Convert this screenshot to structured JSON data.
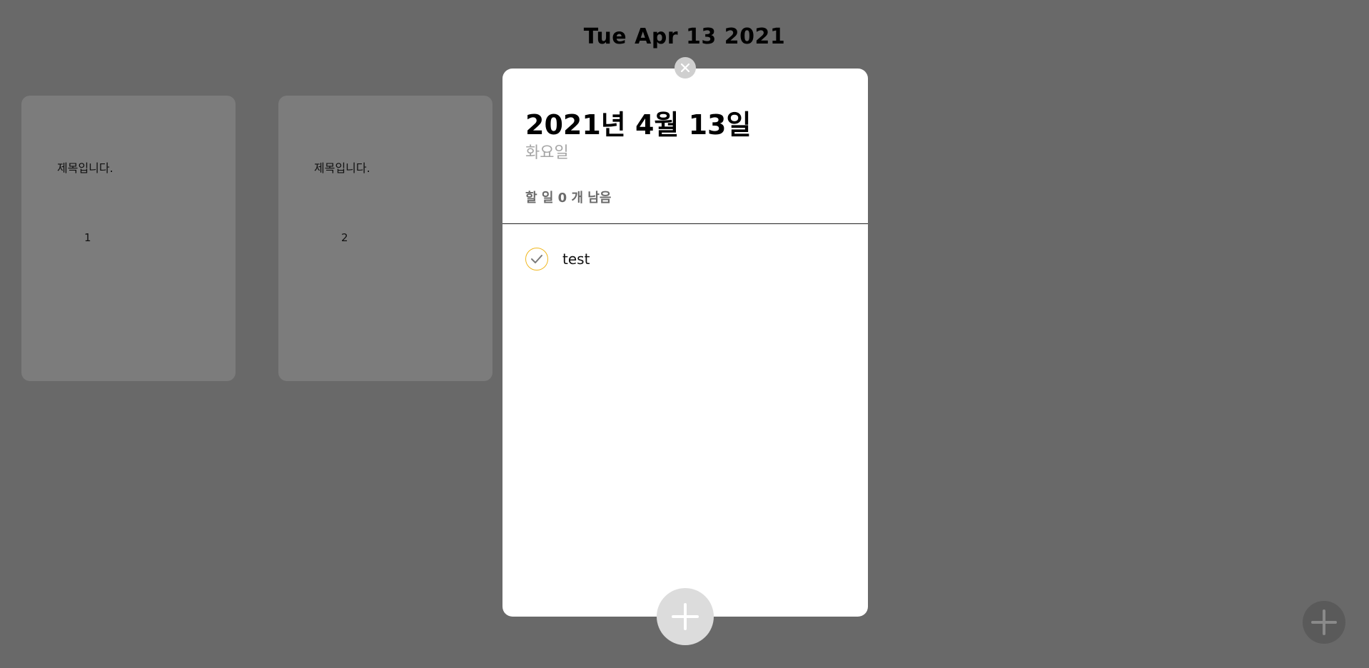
{
  "header": {
    "date": "Tue Apr 13 2021"
  },
  "cards": [
    {
      "title": "제목입니다.",
      "number": "1"
    },
    {
      "title": "제목입니다.",
      "number": "2"
    }
  ],
  "modal": {
    "date": "2021년 4월 13일",
    "weekday": "화요일",
    "remaining": "할 일 0 개 남음",
    "todos": [
      {
        "text": "test",
        "done": true
      }
    ]
  },
  "colors": {
    "background": "#696969",
    "card": "#7c7c7c",
    "check_border": "#f0b71f",
    "modal_background": "#ffffff"
  },
  "icons": {
    "close": "close-icon",
    "check": "check-icon",
    "add": "plus-icon"
  }
}
